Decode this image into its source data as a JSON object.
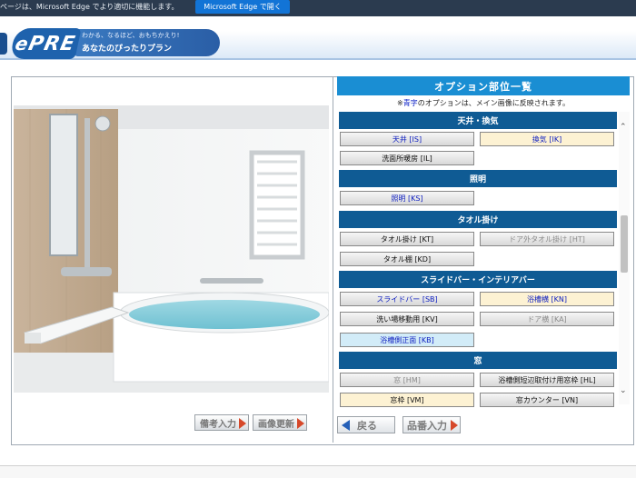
{
  "browser_notice": {
    "message": "ページは、Microsoft Edge でより適切に機能します。",
    "button_label": "Microsoft Edge で開く"
  },
  "header": {
    "logo_text": "PRE",
    "tagline": "わかる、なるほど、おもちかえり!",
    "subtitle": "あなたのぴったりプラン"
  },
  "image_buttons": {
    "remarks": "備考入力",
    "update": "画像更新"
  },
  "options_panel": {
    "title": "オプション部位一覧",
    "note_prefix": "※",
    "note_blue": "青字",
    "note_suffix": "のオプションは、メイン画像に反映されます。",
    "sections": [
      {
        "title": "天井・換気",
        "items": [
          {
            "label": "天井 [IS]",
            "style": "blue"
          },
          {
            "label": "換気 [IK]",
            "style": "blue-yellow"
          },
          {
            "label": "洗面所暖房 [IL]",
            "style": "normal"
          }
        ]
      },
      {
        "title": "照明",
        "items": [
          {
            "label": "照明 [KS]",
            "style": "blue"
          }
        ]
      },
      {
        "title": "タオル掛け",
        "items": [
          {
            "label": "タオル掛け [KT]",
            "style": "normal"
          },
          {
            "label": "ドア外タオル掛け [HT]",
            "style": "gray"
          },
          {
            "label": "タオル棚 [KD]",
            "style": "normal"
          }
        ]
      },
      {
        "title": "スライドバー・インテリアバー",
        "items": [
          {
            "label": "スライドバー [SB]",
            "style": "blue"
          },
          {
            "label": "浴槽横 [KN]",
            "style": "blue-yellow"
          },
          {
            "label": "洗い場移動用 [KV]",
            "style": "normal"
          },
          {
            "label": "ドア横 [KA]",
            "style": "gray"
          },
          {
            "label": "浴槽側正面 [KB]",
            "style": "blue-lightblue"
          }
        ]
      },
      {
        "title": "窓",
        "items": [
          {
            "label": "窓 [HM]",
            "style": "gray"
          },
          {
            "label": "浴槽側短辺取付け用窓枠 [HL]",
            "style": "normal"
          },
          {
            "label": "窓枠 [VM]",
            "style": "yellow"
          },
          {
            "label": "窓カウンター [VN]",
            "style": "normal"
          }
        ]
      }
    ]
  },
  "nav": {
    "back": "戻る",
    "product_number": "品番入力"
  },
  "colors": {
    "panel_title": "#1a8ed3",
    "section_header": "#0f5b94",
    "option_blue_text": "#1020c0",
    "highlight_yellow": "#fdf2d3",
    "highlight_lightblue": "#d2ecf8"
  }
}
